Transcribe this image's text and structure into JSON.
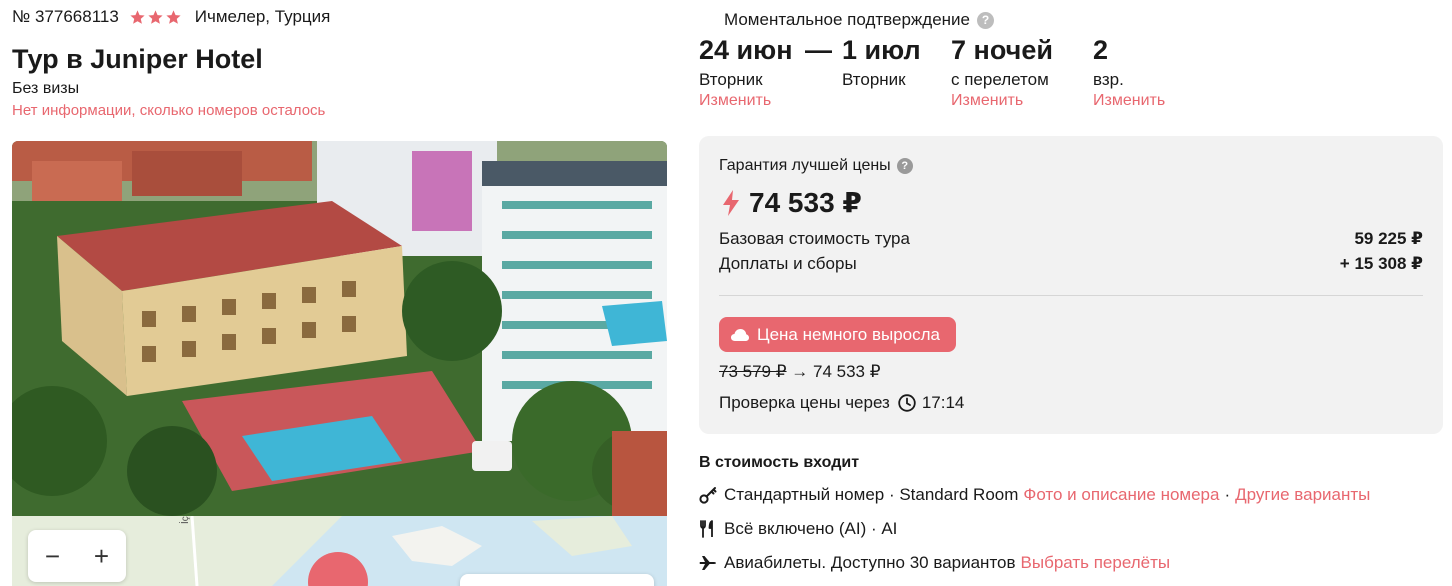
{
  "hotel": {
    "number": "№ 377668113",
    "stars": 3,
    "location": "Ичмелер, Турция",
    "title": "Тур в Juniper Hotel",
    "visa": "Без визы",
    "rooms_info": "Нет информации, сколько номеров осталось"
  },
  "map": {
    "zoom_out": "−",
    "zoom_in": "+",
    "street": "İçmeler Caddesi"
  },
  "booking": {
    "confirmation": "Моментальное подтверждение",
    "help_icon": "question-icon",
    "trip": [
      {
        "value": "24 июн",
        "sub": "Вторник",
        "change": "Изменить"
      },
      {
        "value": "1 июл",
        "sub": "Вторник",
        "change": ""
      },
      {
        "value": "7 ночей",
        "sub": "с перелетом",
        "change": "Изменить"
      },
      {
        "value": "2",
        "sub": "взр.",
        "change": "Изменить"
      }
    ],
    "dash": "—"
  },
  "price": {
    "guarantee": "Гарантия лучшей цены",
    "total": "74 533 ₽",
    "base_label": "Базовая стоимость тура",
    "base_value": "59 225 ₽",
    "fees_label": "Доплаты и сборы",
    "fees_value": "+ 15 308 ₽",
    "rise_badge": "Цена немного выросла",
    "old_price": "73 579 ₽",
    "arrow": "→",
    "new_price": "74 533 ₽",
    "check_label": "Проверка цены через",
    "check_time": "17:14"
  },
  "includes": {
    "title": "В стоимость входит",
    "room_text": "Стандартный номер · Standard Room",
    "room_link": "Фото и описание номера",
    "room_other": "Другие варианты",
    "meal_text": "Всё включено (AI) · AI",
    "flights_text": "Авиабилеты. Доступно 30 вариантов",
    "flights_link": "Выбрать перелёты"
  },
  "colors": {
    "accent": "#e8676f",
    "card_bg": "#f2f2f2",
    "text": "#1a1a1a"
  }
}
